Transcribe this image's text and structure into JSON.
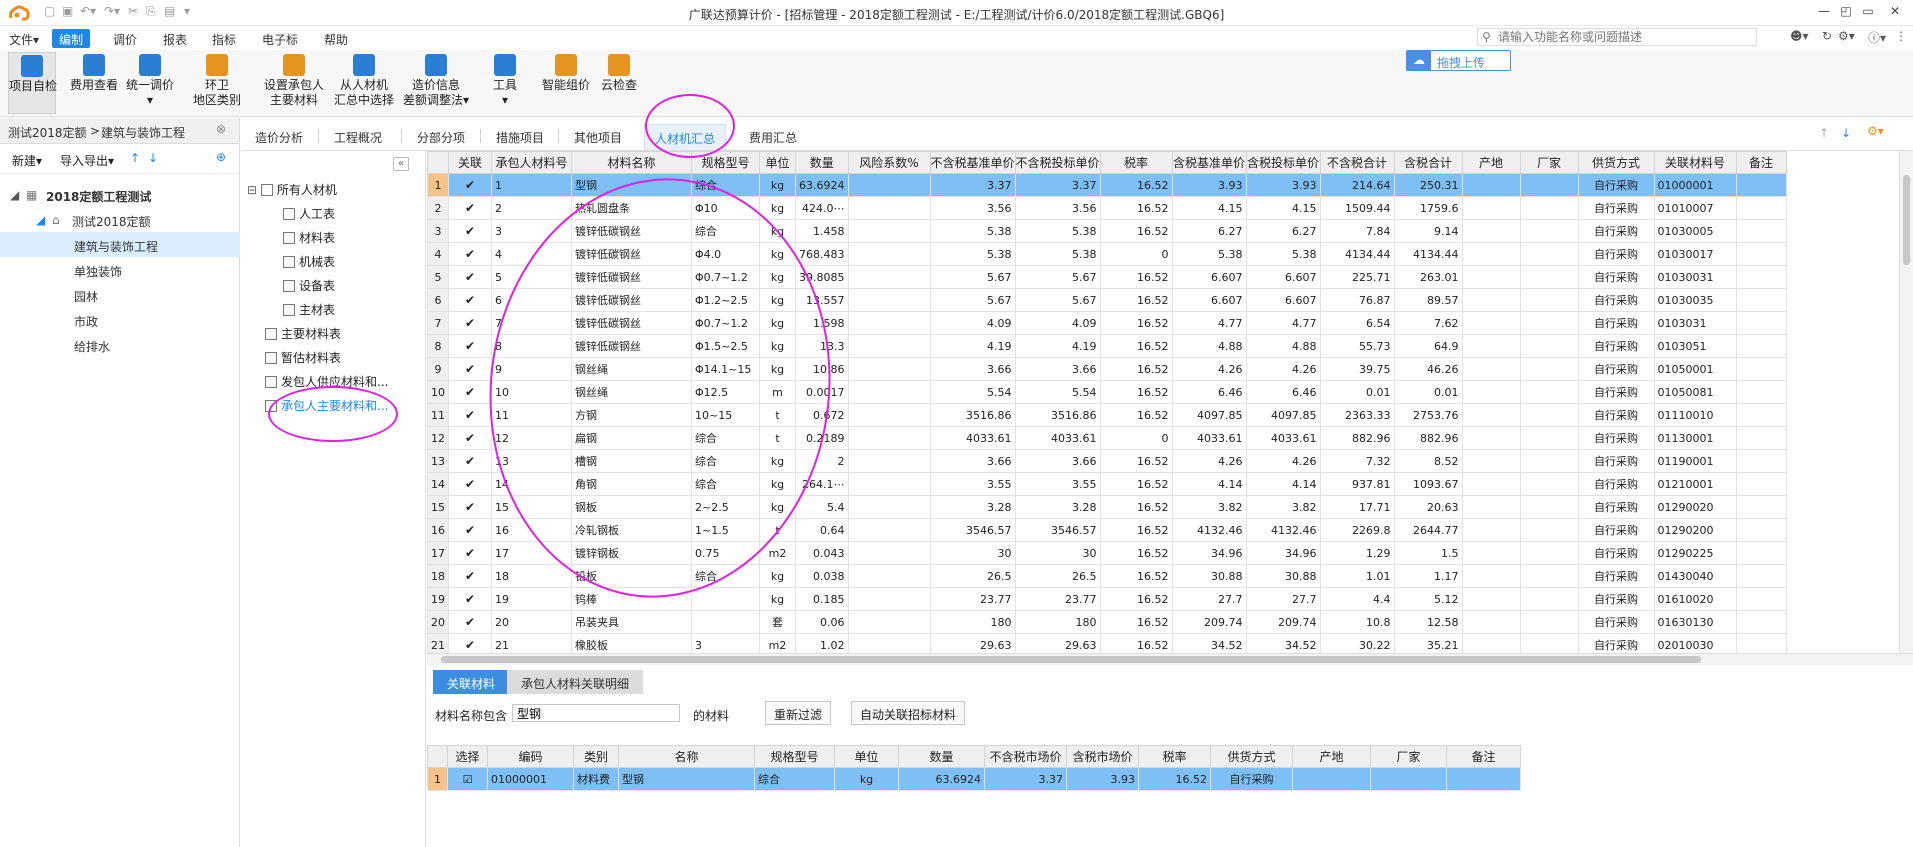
{
  "titlebar": {
    "title": "广联达预算计价 - [招标管理 - 2018定额工程测试 - E:/工程测试/计价6.0/2018定额工程测试.GBQ6]",
    "window_buttons": [
      "—",
      "◰",
      "▭",
      "✕"
    ]
  },
  "menu": {
    "items": [
      "文件▾",
      "编制",
      "调价",
      "报表",
      "指标",
      "电子标",
      "帮助"
    ],
    "active_index": 1
  },
  "search": {
    "placeholder": "请输入功能名称或问题描述"
  },
  "ribbon": {
    "buttons": [
      {
        "label": "项目自检",
        "icon": "check-list-icon",
        "color": "#2a7fd4"
      },
      {
        "label": "费用查看",
        "icon": "money-icon",
        "color": "#2a7fd4"
      },
      {
        "label": "统一调价",
        "icon": "adjust-price-icon",
        "color": "#2a7fd4",
        "label2": "▾"
      },
      {
        "label": "环卫",
        "icon": "sanitation-icon",
        "color": "#e69420",
        "label2": "地区类别"
      },
      {
        "label": "设置承包人",
        "icon": "settings-icon",
        "color": "#e69420",
        "label2": "主要材料"
      },
      {
        "label": "从人材机",
        "icon": "pick-icon",
        "color": "#2a7fd4",
        "label2": "汇总中选择"
      },
      {
        "label": "造价信息",
        "icon": "price-info-icon",
        "color": "#2a7fd4",
        "label2": "差额调整法▾"
      },
      {
        "label": "工具",
        "icon": "tools-icon",
        "color": "#2a7fd4",
        "label2": "▾"
      },
      {
        "label": "智能组价",
        "icon": "smart-price-icon",
        "color": "#e69420"
      },
      {
        "label": "云检查",
        "icon": "cloud-check-icon",
        "color": "#e69420"
      }
    ],
    "upload_label": "拖拽上传"
  },
  "sidebar": {
    "crumb_project": "测试2018定额",
    "crumb_sep": ">",
    "crumb_current": "建筑与装饰工程",
    "new_label": "新建▾",
    "import_label": "导入导出▾",
    "tree": [
      {
        "label": "2018定额工程测试",
        "level": 0,
        "bold": true
      },
      {
        "label": "测试2018定额",
        "level": 1
      },
      {
        "label": "建筑与装饰工程",
        "level": 2,
        "selected": true
      },
      {
        "label": "单独装饰",
        "level": 2
      },
      {
        "label": "园林",
        "level": 2
      },
      {
        "label": "市政",
        "level": 2
      },
      {
        "label": "给排水",
        "level": 2
      }
    ]
  },
  "tabs": {
    "items": [
      "造价分析",
      "工程概况",
      "分部分项",
      "措施项目",
      "其他项目",
      "人材机汇总",
      "费用汇总"
    ],
    "active_index": 5
  },
  "material_tree": {
    "items": [
      {
        "label": "所有人材机",
        "level": 0
      },
      {
        "label": "人工表",
        "level": 1
      },
      {
        "label": "材料表",
        "level": 1
      },
      {
        "label": "机械表",
        "level": 1
      },
      {
        "label": "设备表",
        "level": 1
      },
      {
        "label": "主材表",
        "level": 1
      },
      {
        "label": "主要材料表",
        "level": 0
      },
      {
        "label": "暂估材料表",
        "level": 0
      },
      {
        "label": "发包人供应材料和...",
        "level": 0
      },
      {
        "label": "承包人主要材料和...",
        "level": 0,
        "link": true
      }
    ]
  },
  "grid": {
    "headers": [
      "",
      "关联",
      "承包人材料号",
      "材料名称",
      "规格型号",
      "单位",
      "数量",
      "风险系数%",
      "不含税基准单价",
      "不含税投标单价",
      "税率",
      "含税基准单价",
      "含税投标单价",
      "不含税合计",
      "含税合计",
      "产地",
      "厂家",
      "供货方式",
      "关联材料号",
      "备注"
    ],
    "rows": [
      [
        "1",
        "✔",
        "1",
        "型钢",
        "综合",
        "kg",
        "63.6924",
        "",
        "3.37",
        "3.37",
        "16.52",
        "3.93",
        "3.93",
        "214.64",
        "250.31",
        "",
        "",
        "自行采购",
        "01000001"
      ],
      [
        "2",
        "✔",
        "2",
        "热轧圆盘条",
        "Φ10",
        "kg",
        "424.0⋯",
        "",
        "3.56",
        "3.56",
        "16.52",
        "4.15",
        "4.15",
        "1509.44",
        "1759.6",
        "",
        "",
        "自行采购",
        "01010007"
      ],
      [
        "3",
        "✔",
        "3",
        "镀锌低碳钢丝",
        "综合",
        "kg",
        "1.458",
        "",
        "5.38",
        "5.38",
        "16.52",
        "6.27",
        "6.27",
        "7.84",
        "9.14",
        "",
        "",
        "自行采购",
        "01030005"
      ],
      [
        "4",
        "✔",
        "4",
        "镀锌低碳钢丝",
        "Φ4.0",
        "kg",
        "768.483",
        "",
        "5.38",
        "5.38",
        "0",
        "5.38",
        "5.38",
        "4134.44",
        "4134.44",
        "",
        "",
        "自行采购",
        "01030017"
      ],
      [
        "5",
        "✔",
        "5",
        "镀锌低碳钢丝",
        "Φ0.7~1.2",
        "kg",
        "39.8085",
        "",
        "5.67",
        "5.67",
        "16.52",
        "6.607",
        "6.607",
        "225.71",
        "263.01",
        "",
        "",
        "自行采购",
        "01030031"
      ],
      [
        "6",
        "✔",
        "6",
        "镀锌低碳钢丝",
        "Φ1.2~2.5",
        "kg",
        "13.557",
        "",
        "5.67",
        "5.67",
        "16.52",
        "6.607",
        "6.607",
        "76.87",
        "89.57",
        "",
        "",
        "自行采购",
        "01030035"
      ],
      [
        "7",
        "✔",
        "7",
        "镀锌低碳钢丝",
        "Φ0.7~1.2",
        "kg",
        "1.598",
        "",
        "4.09",
        "4.09",
        "16.52",
        "4.77",
        "4.77",
        "6.54",
        "7.62",
        "",
        "",
        "自行采购",
        "0103031"
      ],
      [
        "8",
        "✔",
        "8",
        "镀锌低碳钢丝",
        "Φ1.5~2.5",
        "kg",
        "13.3",
        "",
        "4.19",
        "4.19",
        "16.52",
        "4.88",
        "4.88",
        "55.73",
        "64.9",
        "",
        "",
        "自行采购",
        "0103051"
      ],
      [
        "9",
        "✔",
        "9",
        "钢丝绳",
        "Φ14.1~15",
        "kg",
        "10.86",
        "",
        "3.66",
        "3.66",
        "16.52",
        "4.26",
        "4.26",
        "39.75",
        "46.26",
        "",
        "",
        "自行采购",
        "01050001"
      ],
      [
        "10",
        "✔",
        "10",
        "钢丝绳",
        "Φ12.5",
        "m",
        "0.0017",
        "",
        "5.54",
        "5.54",
        "16.52",
        "6.46",
        "6.46",
        "0.01",
        "0.01",
        "",
        "",
        "自行采购",
        "01050081"
      ],
      [
        "11",
        "✔",
        "11",
        "方钢",
        "10~15",
        "t",
        "0.672",
        "",
        "3516.86",
        "3516.86",
        "16.52",
        "4097.85",
        "4097.85",
        "2363.33",
        "2753.76",
        "",
        "",
        "自行采购",
        "01110010"
      ],
      [
        "12",
        "✔",
        "12",
        "扁钢",
        "综合",
        "t",
        "0.2189",
        "",
        "4033.61",
        "4033.61",
        "0",
        "4033.61",
        "4033.61",
        "882.96",
        "882.96",
        "",
        "",
        "自行采购",
        "01130001"
      ],
      [
        "13",
        "✔",
        "13",
        "槽钢",
        "综合",
        "kg",
        "2",
        "",
        "3.66",
        "3.66",
        "16.52",
        "4.26",
        "4.26",
        "7.32",
        "8.52",
        "",
        "",
        "自行采购",
        "01190001"
      ],
      [
        "14",
        "✔",
        "14",
        "角钢",
        "综合",
        "kg",
        "264.1⋯",
        "",
        "3.55",
        "3.55",
        "16.52",
        "4.14",
        "4.14",
        "937.81",
        "1093.67",
        "",
        "",
        "自行采购",
        "01210001"
      ],
      [
        "15",
        "✔",
        "15",
        "钢板",
        "2~2.5",
        "kg",
        "5.4",
        "",
        "3.28",
        "3.28",
        "16.52",
        "3.82",
        "3.82",
        "17.71",
        "20.63",
        "",
        "",
        "自行采购",
        "01290020"
      ],
      [
        "16",
        "✔",
        "16",
        "冷轧钢板",
        "1~1.5",
        "t",
        "0.64",
        "",
        "3546.57",
        "3546.57",
        "16.52",
        "4132.46",
        "4132.46",
        "2269.8",
        "2644.77",
        "",
        "",
        "自行采购",
        "01290200"
      ],
      [
        "17",
        "✔",
        "17",
        "镀锌钢板",
        "0.75",
        "m2",
        "0.043",
        "",
        "30",
        "30",
        "16.52",
        "34.96",
        "34.96",
        "1.29",
        "1.5",
        "",
        "",
        "自行采购",
        "01290225"
      ],
      [
        "18",
        "✔",
        "18",
        "铅板",
        "综合",
        "kg",
        "0.038",
        "",
        "26.5",
        "26.5",
        "16.52",
        "30.88",
        "30.88",
        "1.01",
        "1.17",
        "",
        "",
        "自行采购",
        "01430040"
      ],
      [
        "19",
        "✔",
        "19",
        "钨棒",
        "",
        "kg",
        "0.185",
        "",
        "23.77",
        "23.77",
        "16.52",
        "27.7",
        "27.7",
        "4.4",
        "5.12",
        "",
        "",
        "自行采购",
        "01610020"
      ],
      [
        "20",
        "✔",
        "20",
        "吊装夹具",
        "",
        "套",
        "0.06",
        "",
        "180",
        "180",
        "16.52",
        "209.74",
        "209.74",
        "10.8",
        "12.58",
        "",
        "",
        "自行采购",
        "01630130"
      ],
      [
        "21",
        "✔",
        "21",
        "橡胶板",
        "3",
        "m2",
        "1.02",
        "",
        "29.63",
        "29.63",
        "16.52",
        "34.52",
        "34.52",
        "30.22",
        "35.21",
        "",
        "",
        "自行采购",
        "02010030"
      ]
    ]
  },
  "bottom": {
    "tab_active": "关联材料",
    "tab_other": "承包人材料关联明细",
    "filter_label": "材料名称包含",
    "filter_value": "型钢",
    "filter_suffix": "的材料",
    "refilter_button": "重新过滤",
    "auto_button": "自动关联招标材料",
    "headers": [
      "",
      "选择",
      "编码",
      "类别",
      "名称",
      "规格型号",
      "单位",
      "数量",
      "不含税市场价",
      "含税市场价",
      "税率",
      "供货方式",
      "产地",
      "厂家",
      "备注"
    ],
    "rows": [
      [
        "1",
        "☑",
        "01000001",
        "材料费",
        "型钢",
        "综合",
        "kg",
        "63.6924",
        "3.37",
        "3.93",
        "16.52",
        "自行采购",
        "",
        "",
        ""
      ]
    ]
  },
  "colors": {
    "accent": "#1e88e5",
    "selected_row": "#7ec0f5",
    "annotation": "#e020e0"
  }
}
